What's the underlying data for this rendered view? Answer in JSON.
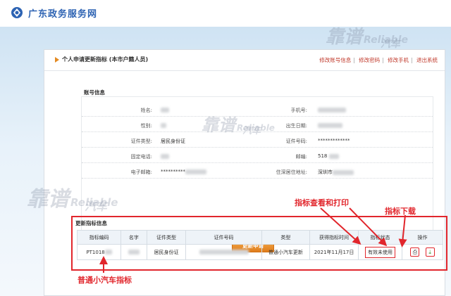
{
  "header": {
    "site_title": "广东政务服务网"
  },
  "panel": {
    "title": "个人申请更新指标 (本市户籍人员)",
    "links": [
      "修改账号信息",
      "修改密码",
      "修改手机",
      "退出系统"
    ]
  },
  "account": {
    "section_title": "账号信息",
    "rows": [
      {
        "l1": "姓名:",
        "v1": "",
        "l2": "手机号:",
        "v2": ""
      },
      {
        "l1": "性别:",
        "v1": "",
        "l2": "出生日期:",
        "v2": ""
      },
      {
        "l1": "证件类型:",
        "v1": "居民身份证",
        "l2": "证件号码:",
        "v2": "*************"
      },
      {
        "l1": "固定电话:",
        "v1": "",
        "l2": "邮编:",
        "v2": "518"
      },
      {
        "l1": "电子邮箱:",
        "v1": "**********",
        "l2": "住深居住地址:",
        "v2": "深圳市"
      }
    ]
  },
  "apply_button": "更新申请",
  "update": {
    "section_title": "更新指标信息",
    "headers": [
      "指标编码",
      "名字",
      "证件类型",
      "证件号码",
      "类型",
      "获得指标时间",
      "指标状态",
      "操作"
    ],
    "row": {
      "code": "PT1018",
      "name": "",
      "id_type": "居民身份证",
      "id_no": "",
      "type": "普通小汽车更新",
      "date": "2021年11月17日",
      "status": "有效未使用"
    }
  },
  "annotations": {
    "view_print": "指标查看和打印",
    "download": "指标下载",
    "normal_car": "普通小汽车指标"
  },
  "watermarks": {
    "cn": "靠谱",
    "en": "Reliable",
    "sub": "汽车"
  },
  "icons": {
    "view": "printer-icon",
    "download": "download-icon"
  }
}
